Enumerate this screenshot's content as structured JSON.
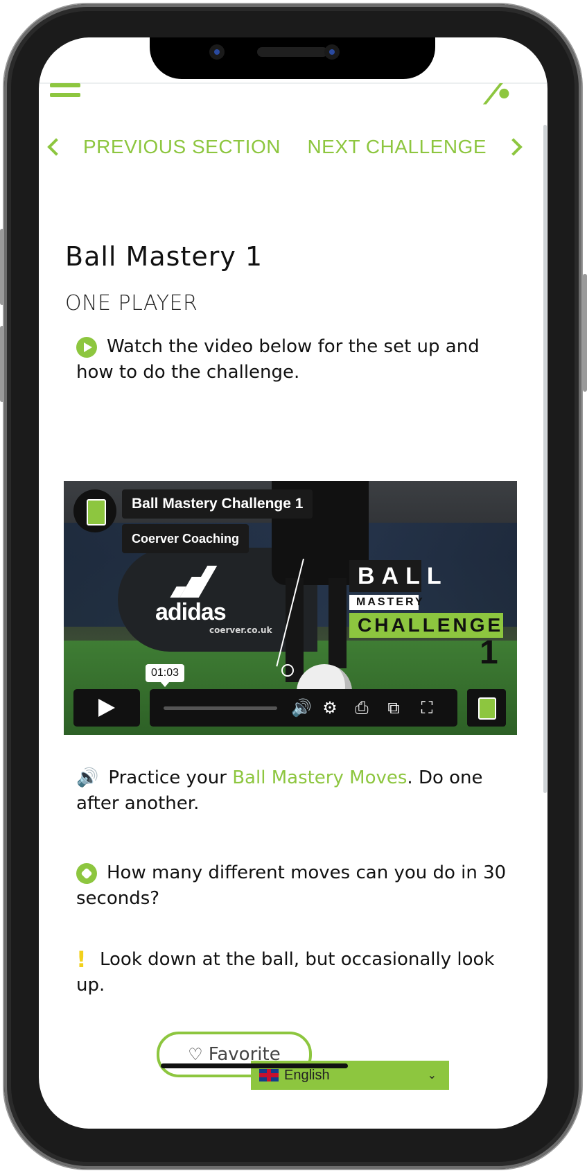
{
  "nav": {
    "prev_label": "PREVIOUS SECTION",
    "next_label": "NEXT CHALLENGE"
  },
  "page": {
    "title": "Ball Mastery 1",
    "subtitle": "ONE PLAYER"
  },
  "instructions": {
    "watch": "Watch the video below for the set up and how to do the challenge.",
    "practice_prefix": "Practice your ",
    "practice_link": "Ball Mastery Moves",
    "practice_suffix": ". Do one after another.",
    "how_many": "How many different moves can you do in 30 seconds?",
    "look": "Look down at the ball, but occasionally look up."
  },
  "video": {
    "title": "Ball Mastery Challenge 1",
    "channel": "Coerver Coaching",
    "timestamp": "01:03",
    "overlay_ball": "BALL",
    "overlay_mastery": "MASTERY",
    "overlay_challenge": "CHALLENGE",
    "overlay_number": "1",
    "brand_text": "adidas",
    "url_text": "coerver.co.uk"
  },
  "favorite": {
    "label": "Favorite"
  },
  "language": {
    "selected": "English"
  },
  "colors": {
    "accent": "#8dc63f",
    "warning": "#f2d11c"
  }
}
